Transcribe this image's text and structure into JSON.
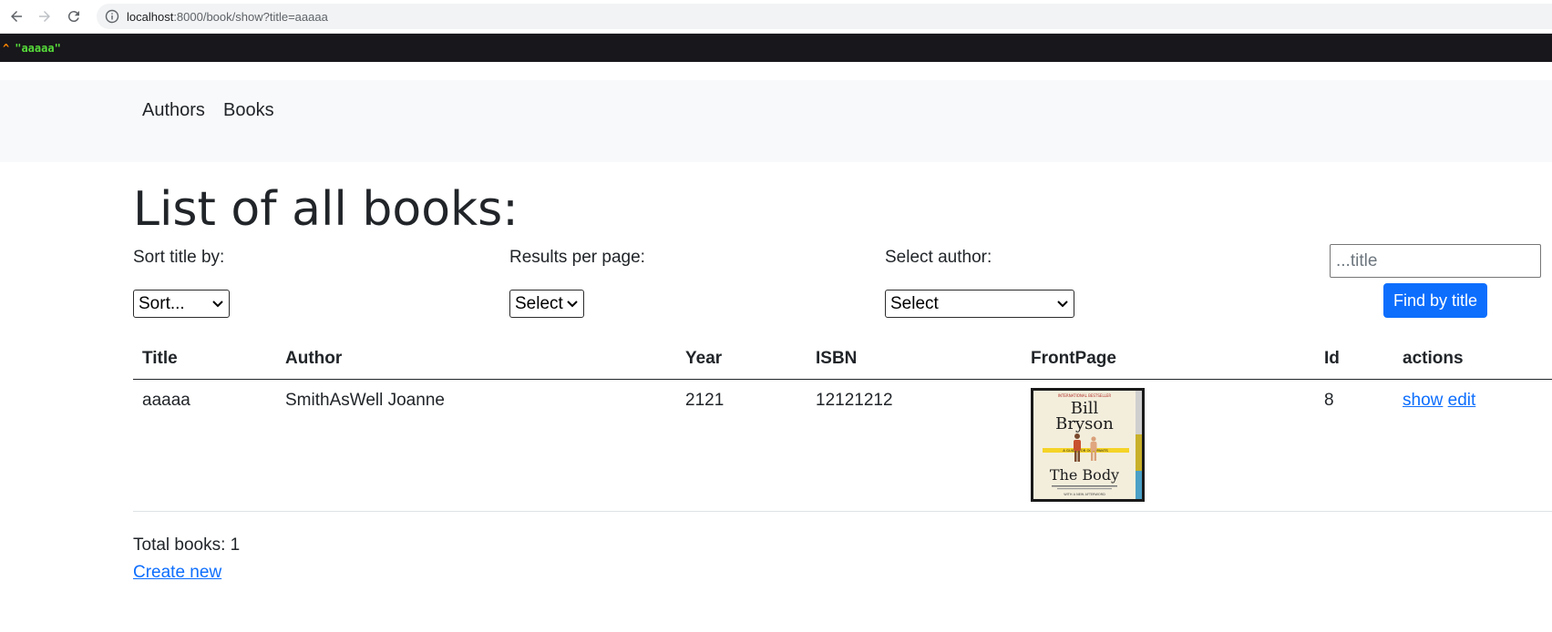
{
  "browser": {
    "url_host": "localhost",
    "url_rest": ":8000/book/show?title=aaaaa"
  },
  "debug": {
    "caret": "^",
    "value": "\"aaaaa\""
  },
  "navbar": {
    "items": [
      {
        "label": "Authors"
      },
      {
        "label": "Books"
      }
    ]
  },
  "main": {
    "title": "List of all books:",
    "sort": {
      "label": "Sort title by:",
      "value": "Sort..."
    },
    "per_page": {
      "label": "Results per page:",
      "value": "Select"
    },
    "author": {
      "label": "Select author:",
      "value": "Select"
    },
    "search": {
      "placeholder": "...title",
      "value": "",
      "button": "Find by title"
    },
    "table": {
      "headers": [
        "Title",
        "Author",
        "Year",
        "ISBN",
        "FrontPage",
        "Id",
        "actions"
      ],
      "rows": [
        {
          "title": "aaaaa",
          "author": "SmithAsWell Joanne",
          "year": "2121",
          "isbn": "12121212",
          "frontpage": {
            "top_line": "INTERNATIONAL BESTSELLER",
            "author_first": "Bill",
            "author_last": "Bryson",
            "subtitle": "A GUIDE FOR OCCUPANTS",
            "book_title": "The Body",
            "bottom_line": "WITH A NEW AFTERWORD"
          },
          "id": "8",
          "actions": [
            "show",
            "edit"
          ]
        }
      ]
    },
    "total_books": "Total books: 1",
    "create_link": "Create new"
  },
  "colors": {
    "primary": "#0d6efd",
    "navbar_bg": "#f8f9fa",
    "dump_bg": "#18171b",
    "dump_caret": "#ff8400",
    "dump_value": "#56db3a"
  }
}
